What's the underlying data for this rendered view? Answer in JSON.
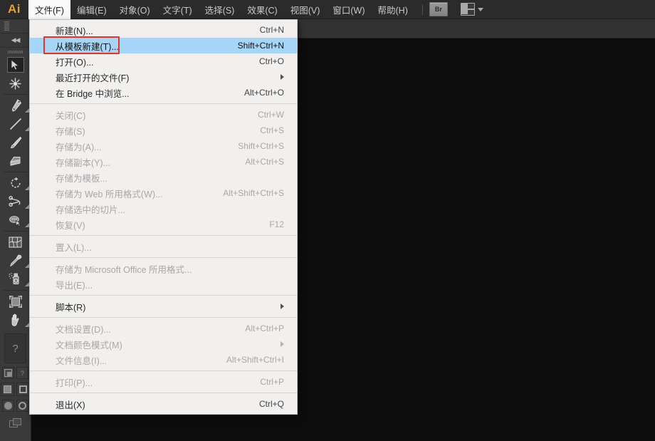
{
  "app": {
    "logo": "Ai"
  },
  "menubar": {
    "items": [
      {
        "label": "文件(F)",
        "name": "menu-file",
        "open": true
      },
      {
        "label": "编辑(E)",
        "name": "menu-edit",
        "open": false
      },
      {
        "label": "对象(O)",
        "name": "menu-object",
        "open": false
      },
      {
        "label": "文字(T)",
        "name": "menu-type",
        "open": false
      },
      {
        "label": "选择(S)",
        "name": "menu-select",
        "open": false
      },
      {
        "label": "效果(C)",
        "name": "menu-effect",
        "open": false
      },
      {
        "label": "视图(V)",
        "name": "menu-view",
        "open": false
      },
      {
        "label": "窗口(W)",
        "name": "menu-window",
        "open": false
      },
      {
        "label": "帮助(H)",
        "name": "menu-help",
        "open": false
      }
    ],
    "bridge_button_label": "Br",
    "arrange_documents_label": "排列文档"
  },
  "file_menu": {
    "groups": [
      {
        "rows": [
          {
            "label": "新建(N)...",
            "shortcut": "Ctrl+N",
            "name": "menu-item-new",
            "disabled": false,
            "selected": false,
            "submenu": false
          },
          {
            "label": "从模板新建(T)...",
            "shortcut": "Shift+Ctrl+N",
            "name": "menu-item-new-from-template",
            "disabled": false,
            "selected": true,
            "submenu": false
          },
          {
            "label": "打开(O)...",
            "shortcut": "Ctrl+O",
            "name": "menu-item-open",
            "disabled": false,
            "selected": false,
            "submenu": false
          },
          {
            "label": "最近打开的文件(F)",
            "shortcut": "",
            "name": "menu-item-open-recent",
            "disabled": false,
            "selected": false,
            "submenu": true
          },
          {
            "label": "在 Bridge 中浏览...",
            "shortcut": "Alt+Ctrl+O",
            "name": "menu-item-browse-in-bridge",
            "disabled": false,
            "selected": false,
            "submenu": false
          }
        ]
      },
      {
        "rows": [
          {
            "label": "关闭(C)",
            "shortcut": "Ctrl+W",
            "name": "menu-item-close",
            "disabled": true,
            "selected": false,
            "submenu": false
          },
          {
            "label": "存储(S)",
            "shortcut": "Ctrl+S",
            "name": "menu-item-save",
            "disabled": true,
            "selected": false,
            "submenu": false
          },
          {
            "label": "存储为(A)...",
            "shortcut": "Shift+Ctrl+S",
            "name": "menu-item-save-as",
            "disabled": true,
            "selected": false,
            "submenu": false
          },
          {
            "label": "存储副本(Y)...",
            "shortcut": "Alt+Ctrl+S",
            "name": "menu-item-save-a-copy",
            "disabled": true,
            "selected": false,
            "submenu": false
          },
          {
            "label": "存储为模板...",
            "shortcut": "",
            "name": "menu-item-save-as-template",
            "disabled": true,
            "selected": false,
            "submenu": false
          },
          {
            "label": "存储为 Web 所用格式(W)...",
            "shortcut": "Alt+Shift+Ctrl+S",
            "name": "menu-item-save-for-web",
            "disabled": true,
            "selected": false,
            "submenu": false
          },
          {
            "label": "存储选中的切片...",
            "shortcut": "",
            "name": "menu-item-save-selected-slices",
            "disabled": true,
            "selected": false,
            "submenu": false
          },
          {
            "label": "恢复(V)",
            "shortcut": "F12",
            "name": "menu-item-revert",
            "disabled": true,
            "selected": false,
            "submenu": false
          }
        ]
      },
      {
        "rows": [
          {
            "label": "置入(L)...",
            "shortcut": "",
            "name": "menu-item-place",
            "disabled": true,
            "selected": false,
            "submenu": false
          }
        ]
      },
      {
        "rows": [
          {
            "label": "存储为 Microsoft Office 所用格式...",
            "shortcut": "",
            "name": "menu-item-save-for-office",
            "disabled": true,
            "selected": false,
            "submenu": false
          },
          {
            "label": "导出(E)...",
            "shortcut": "",
            "name": "menu-item-export",
            "disabled": true,
            "selected": false,
            "submenu": false
          }
        ]
      },
      {
        "rows": [
          {
            "label": "脚本(R)",
            "shortcut": "",
            "name": "menu-item-scripts",
            "disabled": false,
            "selected": false,
            "submenu": true
          }
        ]
      },
      {
        "rows": [
          {
            "label": "文档设置(D)...",
            "shortcut": "Alt+Ctrl+P",
            "name": "menu-item-document-setup",
            "disabled": true,
            "selected": false,
            "submenu": false
          },
          {
            "label": "文档颜色模式(M)",
            "shortcut": "",
            "name": "menu-item-document-color-mode",
            "disabled": true,
            "selected": false,
            "submenu": true
          },
          {
            "label": "文件信息(I)...",
            "shortcut": "Alt+Shift+Ctrl+I",
            "name": "menu-item-file-info",
            "disabled": true,
            "selected": false,
            "submenu": false
          }
        ]
      },
      {
        "rows": [
          {
            "label": "打印(P)...",
            "shortcut": "Ctrl+P",
            "name": "menu-item-print",
            "disabled": true,
            "selected": false,
            "submenu": false
          }
        ]
      },
      {
        "rows": [
          {
            "label": "退出(X)",
            "shortcut": "Ctrl+Q",
            "name": "menu-item-exit",
            "disabled": false,
            "selected": false,
            "submenu": false
          }
        ]
      }
    ]
  },
  "toolbar": {
    "collapse_label": "◀◀",
    "help_label": "?",
    "tools": [
      {
        "name": "selection-tool",
        "active": true,
        "corner": false
      },
      {
        "name": "magic-wand-tool",
        "active": false,
        "corner": false
      },
      {
        "name": "pen-tool",
        "active": false,
        "corner": true
      },
      {
        "name": "line-segment-tool",
        "active": false,
        "corner": true
      },
      {
        "name": "paintbrush-tool",
        "active": false,
        "corner": false
      },
      {
        "name": "blob-brush-tool",
        "active": false,
        "corner": false
      },
      {
        "name": "rotate-tool",
        "active": false,
        "corner": true
      },
      {
        "name": "scale-tool",
        "active": false,
        "corner": true
      },
      {
        "name": "width-tool",
        "active": false,
        "corner": true
      },
      {
        "name": "mesh-tool",
        "active": false,
        "corner": false
      },
      {
        "name": "eyedropper-tool",
        "active": false,
        "corner": true
      },
      {
        "name": "symbol-sprayer-tool",
        "active": false,
        "corner": true
      },
      {
        "name": "artboard-tool",
        "active": false,
        "corner": false
      },
      {
        "name": "hand-tool",
        "active": false,
        "corner": true
      }
    ]
  },
  "annotation": {
    "highlight_color": "#ee3124",
    "target": "从模板新建(T)..."
  },
  "colors": {
    "menubar_bg": "#2b2b2b",
    "controlbar_bg": "#323232",
    "toolbar_bg": "#3a3a3a",
    "canvas_bg": "#0c0c0c",
    "menu_bg": "#f1f0ef",
    "menu_selected_bg": "#a6d6f7",
    "accent_logo": "#e8a02c"
  }
}
